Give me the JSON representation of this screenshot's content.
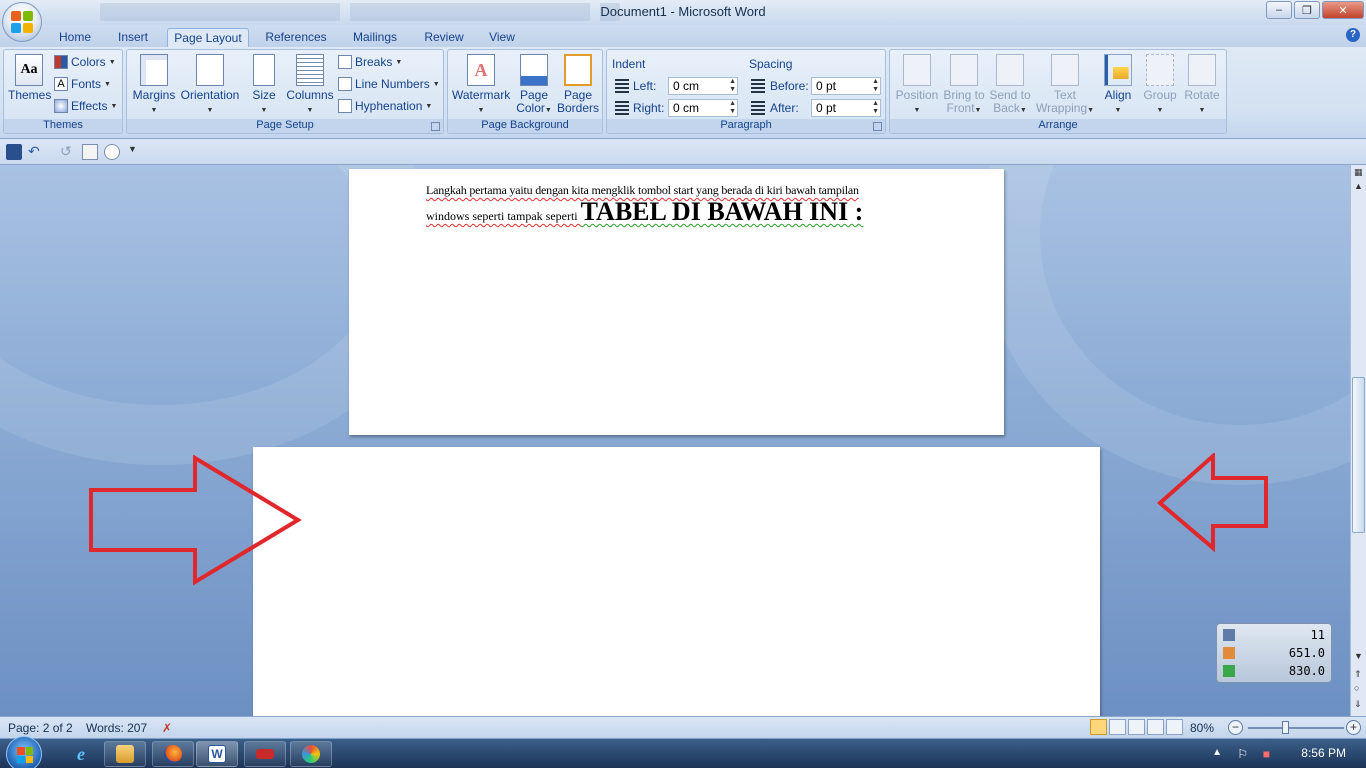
{
  "window": {
    "title": "Document1 - Microsoft Word"
  },
  "tabs": [
    {
      "label": "Home"
    },
    {
      "label": "Insert"
    },
    {
      "label": "Page Layout"
    },
    {
      "label": "References"
    },
    {
      "label": "Mailings"
    },
    {
      "label": "Review"
    },
    {
      "label": "View"
    }
  ],
  "ribbon": {
    "themes": {
      "group_label": "Themes",
      "themes_btn": "Themes",
      "colors": "Colors",
      "fonts": "Fonts",
      "effects": "Effects"
    },
    "page_setup": {
      "group_label": "Page Setup",
      "margins": "Margins",
      "orientation": "Orientation",
      "size": "Size",
      "columns": "Columns",
      "breaks": "Breaks",
      "line_numbers": "Line Numbers",
      "hyphenation": "Hyphenation"
    },
    "page_background": {
      "group_label": "Page Background",
      "watermark": "Watermark",
      "page_color_1": "Page",
      "page_color_2": "Color",
      "page_borders_1": "Page",
      "page_borders_2": "Borders"
    },
    "paragraph": {
      "group_label": "Paragraph",
      "indent_title": "Indent",
      "left_label": "Left:",
      "left_value": "0 cm",
      "right_label": "Right:",
      "right_value": "0 cm",
      "spacing_title": "Spacing",
      "before_label": "Before:",
      "before_value": "0 pt",
      "after_label": "After:",
      "after_value": "0 pt"
    },
    "arrange": {
      "group_label": "Arrange",
      "position": "Position",
      "bring_to_front_1": "Bring to",
      "bring_to_front_2": "Front",
      "send_to_back_1": "Send to",
      "send_to_back_2": "Back",
      "text_wrapping_1": "Text",
      "text_wrapping_2": "Wrapping",
      "align": "Align",
      "group": "Group",
      "rotate": "Rotate"
    }
  },
  "document": {
    "line1": "Langkah pertama yaitu dengan kita mengklik tombol start yang berada di kiri bawah tampilan",
    "line2_small": "windows seperti tampak seperti ",
    "line2_big": "TABEL DI BAWAH INI :"
  },
  "gadget": {
    "row1": "11",
    "row2": "651.0",
    "row3": "830.0"
  },
  "status": {
    "page": "Page: 2 of 2",
    "words": "Words: 207",
    "zoom": "80%",
    "zoom_level_percent": 80
  },
  "taskbar": {
    "clock": "8:56 PM"
  },
  "colors": {
    "arrow": "#e0282c",
    "accent": "#15428b"
  }
}
